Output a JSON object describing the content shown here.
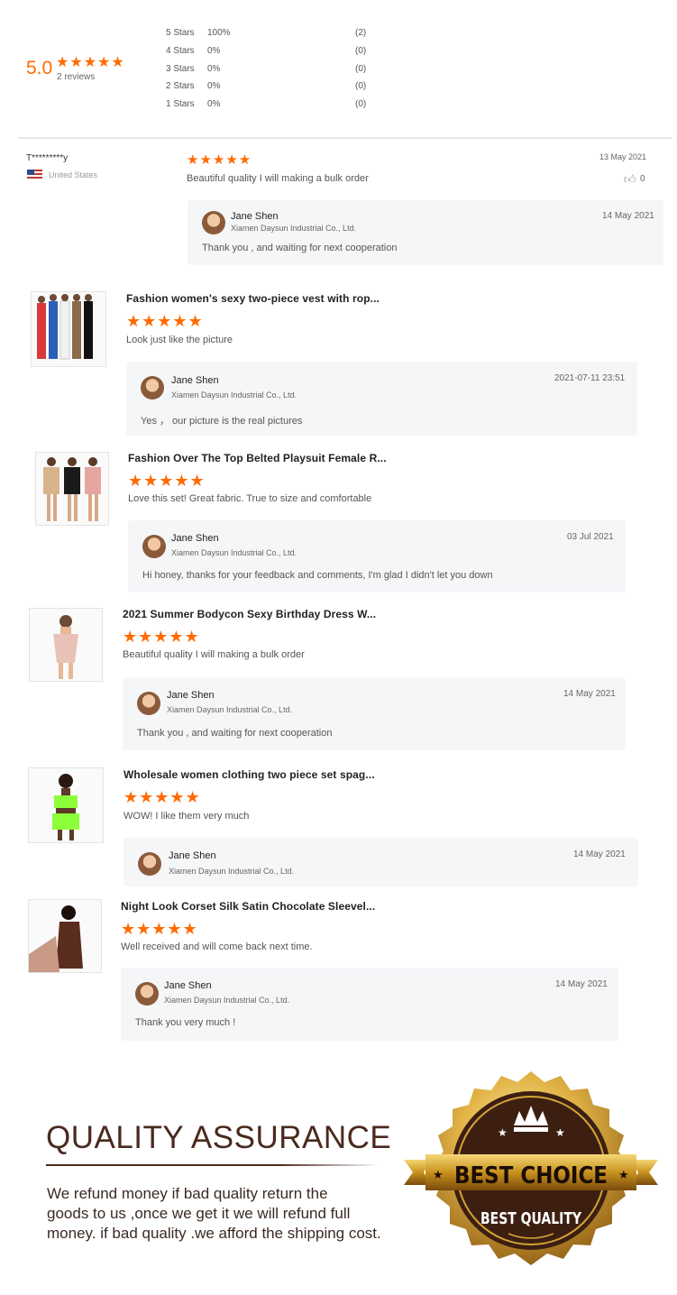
{
  "summary": {
    "score": "5.0",
    "stars": "★★★★★",
    "reviews": "2 reviews",
    "distribution": [
      {
        "label": "5 Stars",
        "pct": "100%",
        "count": "(2)"
      },
      {
        "label": "4 Stars",
        "pct": "0%",
        "count": "(0)"
      },
      {
        "label": "3 Stars",
        "pct": "0%",
        "count": "(0)"
      },
      {
        "label": "2 Stars",
        "pct": "0%",
        "count": "(0)"
      },
      {
        "label": "1 Stars",
        "pct": "0%",
        "count": "(0)"
      }
    ]
  },
  "first_review": {
    "user": "T*********y",
    "country": "United States",
    "stars": "★★★★★",
    "date": "13 May 2021",
    "text": "Beautiful quality I will making a bulk order",
    "likes": "0",
    "reply": {
      "name": "Jane Shen",
      "company": "Xiamen Daysun Industrial Co., Ltd.",
      "date": "14 May 2021",
      "text": "Thank you , and waiting for next cooperation"
    }
  },
  "reviews": [
    {
      "title": "Fashion women's sexy two-piece vest with rop...",
      "stars": "★★★★★",
      "text": "Look just like the picture",
      "reply": {
        "name": "Jane Shen",
        "company": "Xiamen Daysun Industrial Co., Ltd.",
        "date": "2021-07-11 23:51",
        "text": "Yes ， our picture is the real pictures"
      }
    },
    {
      "title": "Fashion Over The Top Belted Playsuit Female R...",
      "stars": "★★★★★",
      "text": "Love this set! Great fabric. True to size and comfortable",
      "reply": {
        "name": "Jane Shen",
        "company": "Xiamen Daysun Industrial Co., Ltd.",
        "date": "03 Jul 2021",
        "text": "Hi honey, thanks for your feedback and comments, I'm glad I didn't let you down"
      }
    },
    {
      "title": "2021 Summer Bodycon Sexy Birthday Dress W...",
      "stars": "★★★★★",
      "text": "Beautiful quality I will making a bulk order",
      "reply": {
        "name": "Jane Shen",
        "company": "Xiamen Daysun Industrial Co., Ltd.",
        "date": "14 May 2021",
        "text": "Thank you , and waiting for next cooperation"
      }
    },
    {
      "title": "Wholesale women clothing two piece set spag...",
      "stars": "★★★★★",
      "text": "WOW! I like them very much",
      "reply": {
        "name": "Jane Shen",
        "company": "Xiamen Daysun Industrial Co., Ltd.",
        "date": "14 May 2021",
        "text": ""
      }
    },
    {
      "title": "Night Look Corset Silk Satin Chocolate Sleevel...",
      "stars": "★★★★★",
      "text": "Well received and will come back next time.",
      "reply": {
        "name": "Jane Shen",
        "company": "Xiamen Daysun Industrial Co., Ltd.",
        "date": "14 May 2021",
        "text": "Thank you very much !"
      }
    }
  ],
  "quality": {
    "heading": "QUALITY ASSURANCE",
    "body_line1": "We refund money if bad quality return the",
    "body_line2": "goods to us ,once we get it we will refund full",
    "body_line3": "money. if bad quality .we afford the shipping cost.",
    "badge_top": "BEST CHOICE",
    "badge_bottom": "BEST QUALITY"
  },
  "colors": {
    "accent": "#ff6a00",
    "heading": "#4a2a1e",
    "gold": "#d4a437",
    "badge_brown": "#3d1f12"
  }
}
